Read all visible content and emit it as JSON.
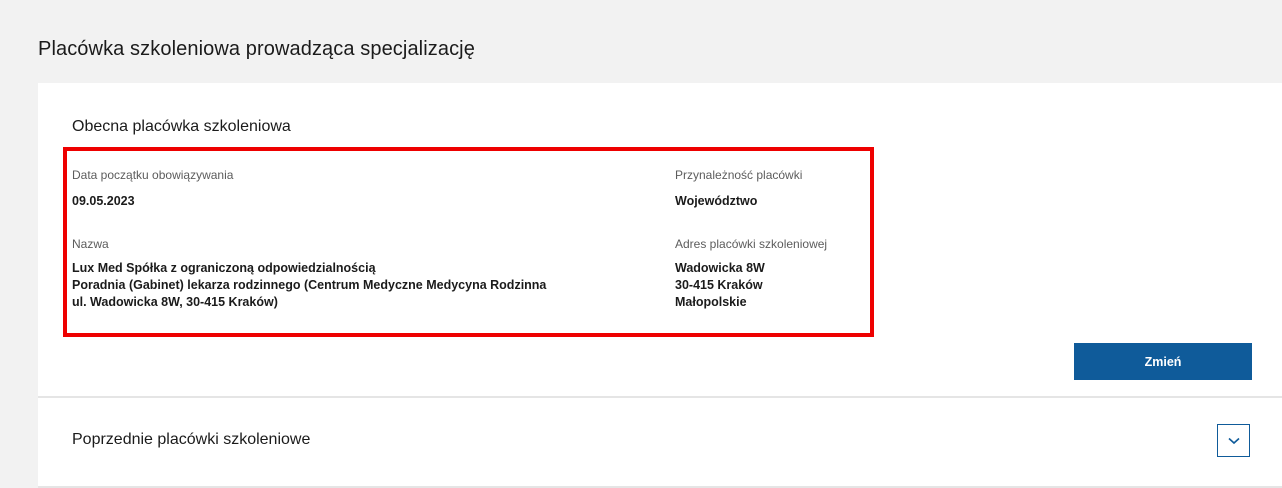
{
  "page": {
    "title": "Placówka szkoleniowa prowadząca specjalizację"
  },
  "current": {
    "section_title": "Obecna placówka szkoleniowa",
    "start_date_label": "Data początku obowiązywania",
    "start_date_value": "09.05.2023",
    "affiliation_label": "Przynależność placówki",
    "affiliation_value": "Województwo",
    "name_label": "Nazwa",
    "name_lines": [
      "Lux Med Spółka z ograniczoną odpowiedzialnością",
      "Poradnia (Gabinet) lekarza rodzinnego (Centrum Medyczne Medycyna Rodzinna",
      "ul. Wadowicka 8W, 30-415 Kraków)"
    ],
    "address_label": "Adres placówki szkoleniowej",
    "address_lines": [
      "Wadowicka 8W",
      "30-415 Kraków",
      "Małopolskie"
    ],
    "change_button_label": "Zmień"
  },
  "previous": {
    "section_title": "Poprzednie placówki szkoleniowe",
    "expand_icon": "chevron-down-icon"
  },
  "colors": {
    "background": "#f2f2f2",
    "card": "#ffffff",
    "primary_button": "#0f5b9a",
    "highlight_border": "#ee0000",
    "label_text": "#5c5c5c"
  }
}
